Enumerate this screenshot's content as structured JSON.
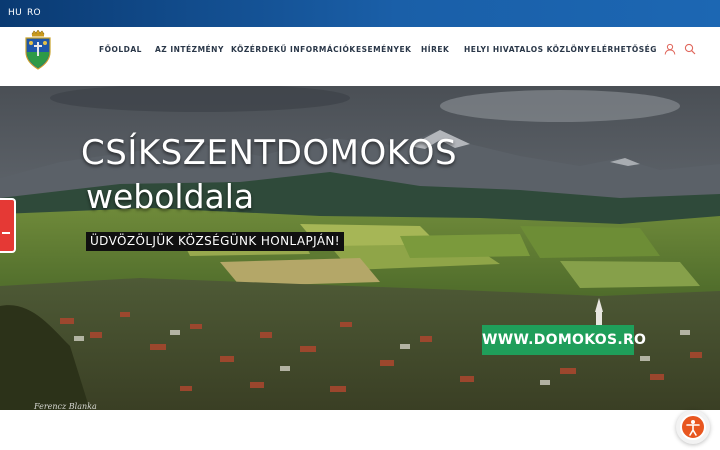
{
  "topbar": {
    "languages": [
      {
        "label": "HU"
      },
      {
        "label": "RO"
      }
    ]
  },
  "header": {
    "logo_icon": "coat-of-arms-icon",
    "nav": [
      {
        "label": "FŐOLDAL"
      },
      {
        "label": "AZ INTÉZMÉNY"
      },
      {
        "label": "KÖZÉRDEKŰ INFORMÁCIÓK"
      },
      {
        "label": "ESEMÉNYEK"
      },
      {
        "label": "HÍREK"
      },
      {
        "label": "HELYI HIVATALOS KÖZLÖNY"
      },
      {
        "label": "ELÉRHETŐSÉG"
      }
    ],
    "icons": [
      "user-icon",
      "search-icon"
    ]
  },
  "hero": {
    "title": "CSÍKSZENTDOMOKOS",
    "subtitle": "weboldala",
    "tagline": "ÜDVÖZÖLJÜK KÖZSÉGÜNK HONLAPJÁN!",
    "cta_label": "WWW.DOMOKOS.RO",
    "photo_credit": "Ferencz Blanka"
  },
  "widgets": {
    "side_tab_icon": "feedback-tab-icon",
    "accessibility_icon": "accessibility-icon"
  },
  "colors": {
    "topbar": "#1a5fa8",
    "nav_text": "#2a3748",
    "cta": "#1f9e5a",
    "accessibility": "#e8561f",
    "side_tab": "#e53935"
  }
}
